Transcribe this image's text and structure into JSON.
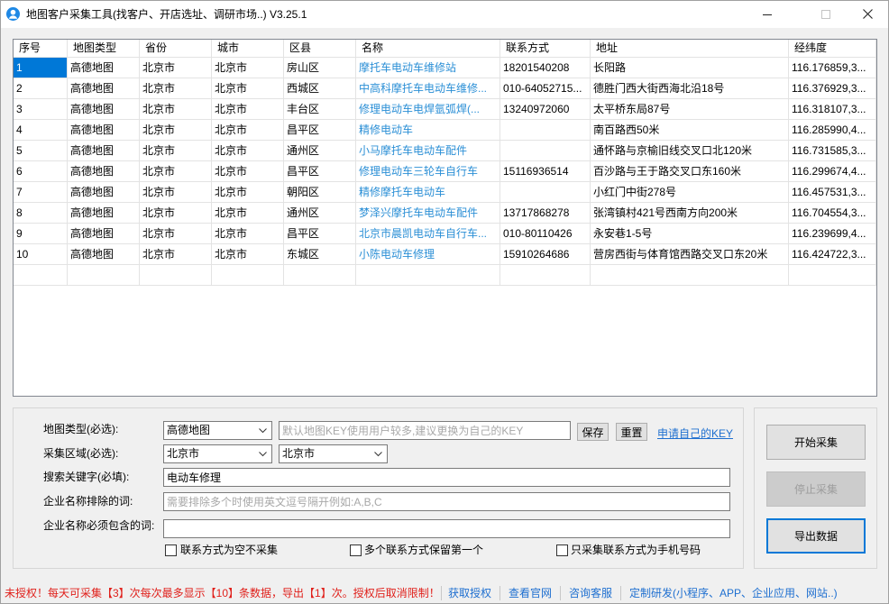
{
  "window": {
    "title": "地图客户采集工具(找客户、开店选址、调研市场..) V3.25.1"
  },
  "icons": {
    "app": "user-icon",
    "window_controls": [
      "minimize-icon",
      "maximize-icon",
      "close-icon"
    ],
    "dropdown": "chevron-down-icon"
  },
  "colors": {
    "accent": "#0078d7",
    "name_text": "#2b8fd6",
    "link": "#1e6fd0",
    "warning": "#e0201b"
  },
  "table": {
    "columns": [
      "序号",
      "地图类型",
      "省份",
      "城市",
      "区县",
      "名称",
      "联系方式",
      "地址",
      "经纬度"
    ],
    "selected_row": 0,
    "rows": [
      [
        "1",
        "高德地图",
        "北京市",
        "北京市",
        "房山区",
        "摩托车电动车维修站",
        "18201540208",
        "长阳路",
        "116.176859,3..."
      ],
      [
        "2",
        "高德地图",
        "北京市",
        "北京市",
        "西城区",
        "中高科摩托车电动车维修...",
        "010-64052715...",
        "德胜门西大街西海北沿18号",
        "116.376929,3..."
      ],
      [
        "3",
        "高德地图",
        "北京市",
        "北京市",
        "丰台区",
        "修理电动车电焊氩弧焊(...",
        "13240972060",
        "太平桥东局87号",
        "116.318107,3..."
      ],
      [
        "4",
        "高德地图",
        "北京市",
        "北京市",
        "昌平区",
        "精修电动车",
        "",
        "南百路西50米",
        "116.285990,4..."
      ],
      [
        "5",
        "高德地图",
        "北京市",
        "北京市",
        "通州区",
        "小马摩托车电动车配件",
        "",
        "通怀路与京榆旧线交叉口北120米",
        "116.731585,3..."
      ],
      [
        "6",
        "高德地图",
        "北京市",
        "北京市",
        "昌平区",
        "修理电动车三轮车自行车",
        "15116936514",
        "百沙路与王于路交叉口东160米",
        "116.299674,4..."
      ],
      [
        "7",
        "高德地图",
        "北京市",
        "北京市",
        "朝阳区",
        "精修摩托车电动车",
        "",
        "小红门中街278号",
        "116.457531,3..."
      ],
      [
        "8",
        "高德地图",
        "北京市",
        "北京市",
        "通州区",
        "梦泽兴摩托车电动车配件",
        "13717868278",
        "张湾镇村421号西南方向200米",
        "116.704554,3..."
      ],
      [
        "9",
        "高德地图",
        "北京市",
        "北京市",
        "昌平区",
        "北京市晨凯电动车自行车...",
        "010-80110426",
        "永安巷1-5号",
        "116.239699,4..."
      ],
      [
        "10",
        "高德地图",
        "北京市",
        "北京市",
        "东城区",
        "小陈电动车修理",
        "15910264686",
        "营房西街与体育馆西路交叉口东20米",
        "116.424722,3..."
      ]
    ]
  },
  "form": {
    "map_type": {
      "label": "地图类型(必选):",
      "value": "高德地图",
      "key_placeholder": "默认地图KEY使用用户较多,建议更换为自己的KEY",
      "save_label": "保存",
      "reset_label": "重置",
      "apply_key_link": "申请自己的KEY"
    },
    "region": {
      "label": "采集区域(必选):",
      "province": "北京市",
      "city": "北京市"
    },
    "keyword": {
      "label": "搜索关键字(必填):",
      "value": "电动车修理"
    },
    "exclude_words": {
      "label": "企业名称排除的词:",
      "placeholder": "需要排除多个时使用英文逗号隔开例如:A,B,C"
    },
    "include_words": {
      "label": "企业名称必须包含的词:"
    },
    "options": [
      {
        "label": "联系方式为空不采集",
        "checked": false
      },
      {
        "label": "多个联系方式保留第一个",
        "checked": false
      },
      {
        "label": "只采集联系方式为手机号码",
        "checked": false
      }
    ]
  },
  "actions": {
    "start_label": "开始采集",
    "stop_label": "停止采集",
    "stop_enabled": false,
    "export_label": "导出数据"
  },
  "status_bar": {
    "notice": "未授权！每天可采集【3】次每次最多显示【10】条数据，导出【1】次。授权后取消限制！",
    "links": [
      "获取授权",
      "查看官网",
      "咨询客服",
      "定制研发(小程序、APP、企业应用、网站..)"
    ]
  }
}
